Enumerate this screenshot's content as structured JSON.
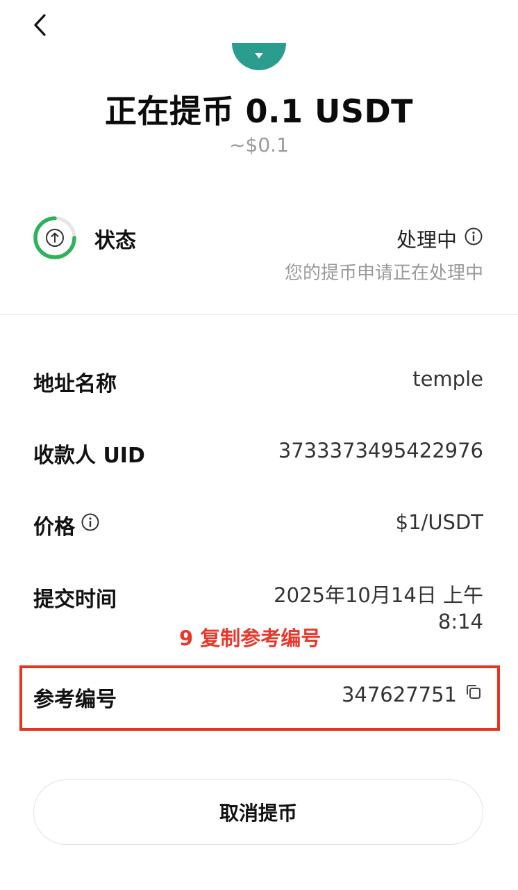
{
  "header": {
    "back_icon": "chevron-left-icon",
    "title": "正在提币 0.1 USDT",
    "subtitle": "~$0.1",
    "coin_color": "#2a9d8f"
  },
  "status": {
    "icon": "upload-circle-icon",
    "label": "状态",
    "value": "处理中",
    "description": "您的提币申请正在处理中",
    "progress_color": "#2db15a",
    "progress_fraction": 0.75
  },
  "details": {
    "address_name": {
      "label": "地址名称",
      "value": "temple"
    },
    "recipient_uid": {
      "label": "收款人 UID",
      "value": "3733373495422976"
    },
    "price": {
      "label": "价格",
      "value": "$1/USDT"
    },
    "submit_time": {
      "label": "提交时间",
      "value_line1": "2025年10月14日 上午",
      "value_line2": "8:14"
    },
    "reference_no": {
      "label": "参考编号",
      "value": "347627751"
    }
  },
  "annotation": {
    "text": "9 复制参考编号",
    "color": "#e8382b"
  },
  "actions": {
    "cancel_label": "取消提币"
  }
}
